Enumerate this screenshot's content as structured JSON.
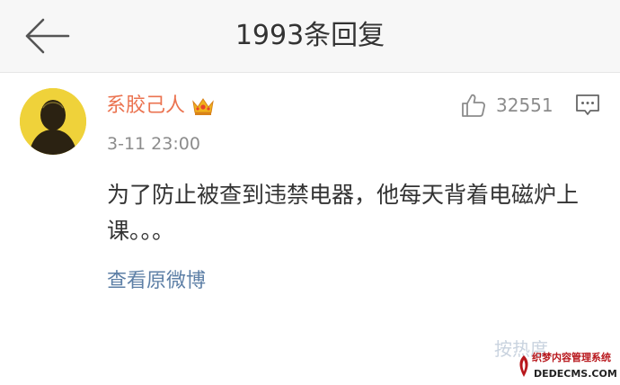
{
  "header": {
    "title": "1993条回复"
  },
  "comment": {
    "username": "系胶己人",
    "timestamp": "3-11 23:00",
    "like_count": "32551",
    "text": "为了防止被查到违禁电器，他每天背着电磁炉上课。。。",
    "view_original_link": "查看原微博"
  },
  "faint_footer": {
    "text": "按热度"
  },
  "watermark": {
    "cn": "织梦内容管理系统",
    "en": "DEDECMS.COM"
  },
  "colors": {
    "username": "#eb7350",
    "link": "#5d7fa6",
    "avatar_bg": "#efd23a",
    "crown": "#f0b31c"
  },
  "icons": {
    "back": "back-arrow-icon",
    "crown": "crown-icon",
    "like": "thumbs-up-icon",
    "reply": "comment-bubble-icon"
  }
}
